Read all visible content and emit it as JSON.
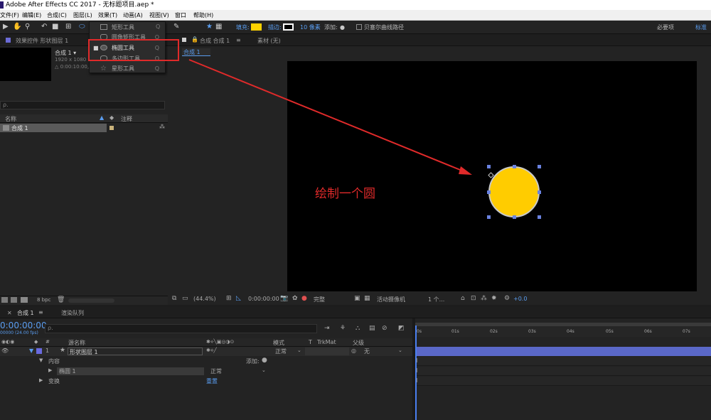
{
  "window": {
    "title": "Adobe After Effects CC 2017 - 无标题项目.aep *"
  },
  "menu": [
    "文件(F)",
    "编辑(E)",
    "合成(C)",
    "图层(L)",
    "效果(T)",
    "动画(A)",
    "视图(V)",
    "窗口",
    "帮助(H)"
  ],
  "toolbar": {
    "fill_label": "填充:",
    "stroke_label": "描边:",
    "stroke_width": "10 像素",
    "add_label": "添加:",
    "bezier_label": "贝塞尔曲线路径",
    "workspace_label": "必要项",
    "standard_label": "标准",
    "fill_color": "#ffd200",
    "stroke_color": "#ffffff"
  },
  "shape_menu": {
    "items": [
      {
        "label": "矩形工具",
        "key": "Q",
        "icon": "rectangle-icon"
      },
      {
        "label": "圆角矩形工具",
        "key": "Q",
        "icon": "rounded-rectangle-icon"
      },
      {
        "label": "椭圆工具",
        "key": "Q",
        "icon": "ellipse-icon",
        "selected": true
      },
      {
        "label": "多边形工具",
        "key": "Q",
        "icon": "polygon-icon"
      },
      {
        "label": "星形工具",
        "key": "Q",
        "icon": "star-icon"
      }
    ]
  },
  "left_panel": {
    "tab_label": "效果控件 形状图层 1",
    "comp_name": "合成 1 ▾",
    "comp_res": "1920 x 1080 (",
    "comp_dur": "△ 0:00:10:00,",
    "search_placeholder": "ρ.",
    "col_name": "名称",
    "col_comment": "注释",
    "item_name": "合成 1",
    "bpc": "8 bpc"
  },
  "viewer": {
    "tab_label": "合成 合成 1",
    "footage_label": "素材 (无)",
    "sub_tab": "合成 1",
    "annotation": "绘制一个圆",
    "zoom": "(44.4%)",
    "timecode": "0:00:00:00",
    "quality": "完整",
    "camera": "活动摄像机",
    "views": "1 个...",
    "exposure": "+0.0",
    "circle_color": "#ffcc00"
  },
  "timeline": {
    "tab_comp": "合成 1",
    "tab_render": "渲染队列",
    "timecode": "0:00:00:00",
    "fps": "00000 (24.00 fps)",
    "search_placeholder": "ρ.",
    "col_source": "源名称",
    "col_mode": "模式",
    "col_t": "T",
    "col_trkmat": "TrkMat",
    "col_parent": "父级",
    "layer_num": "1",
    "layer_name": "形状图层 1",
    "layer_mode": "正常",
    "layer_parent": "无",
    "contents_label": "内容",
    "add_label": "添加:",
    "ellipse_label": "椭圆 1",
    "ellipse_mode": "正常",
    "transform_label": "变换",
    "reset_label": "重置",
    "ruler": [
      "0s",
      "01s",
      "02s",
      "03s",
      "04s",
      "05s",
      "06s",
      "07s"
    ]
  }
}
